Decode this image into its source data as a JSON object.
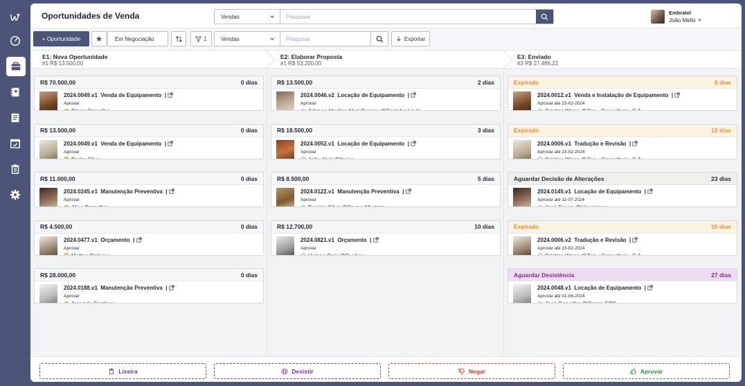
{
  "app": {
    "title": "Oportunidades de Venda"
  },
  "header_search": {
    "select": "Vendas",
    "placeholder": "Pesquisar"
  },
  "user": {
    "company": "Embratel",
    "name": "João Mello"
  },
  "toolbar": {
    "new_label": "+ Oportunidade",
    "status_filter": "Em Negociação",
    "filter_count": "1",
    "select": "Vendas",
    "placeholder": "Pesquisar",
    "export_label": "Exportar"
  },
  "stages": [
    {
      "name": "E1: Nova Oportunidade",
      "summary": "#1 R$ 13.500,00"
    },
    {
      "name": "E2: Elaborar Proposta",
      "summary": "#1 R$ 53.200,00"
    },
    {
      "name": "E3: Enviado",
      "summary": "#3 R$ 27.486,22"
    }
  ],
  "columns": [
    {
      "cards": [
        {
          "header": "R$ 70.500,00",
          "days": "0 dias",
          "ref": "2024.0049.v1",
          "title": "Venda de Equipamento",
          "action": "Aprovar",
          "who": "Diana Carvalho",
          "dot": "y"
        },
        {
          "header": "R$ 13.500,00",
          "days": "0 dias",
          "ref": "2024.0049.v1",
          "title": "Venda de Equipamento",
          "action": "Aprovar",
          "who": "Pedro Silva",
          "dot": "y"
        },
        {
          "header": "R$ 11.000,00",
          "days": "0 dias",
          "ref": "2024.0245.v1",
          "title": "Manutenção Preventiva",
          "action": "Aprovar",
          "who": "Alice Ramalho",
          "dot": "y"
        },
        {
          "header": "R$ 4.500,00",
          "days": "0 dias",
          "ref": "2024.0477.v1",
          "title": "Orçamento",
          "action": "Aprovar",
          "who": "Matteo Pinheiro",
          "dot": "y"
        },
        {
          "header": "R$ 28.000,00",
          "days": "0 dias",
          "ref": "2024.0188.v1",
          "title": "Manutenção Preventiva",
          "action": "Aprovar",
          "who": "Amanda Santiago",
          "dot": "y"
        }
      ]
    },
    {
      "cards": [
        {
          "header": "R$ 13.500,00",
          "days": "2 dias",
          "ref": "2024.0046.v2",
          "title": "Locação de Equipamento",
          "action": "Aprovar",
          "who": "Adriana Martins Abel Pereira @Cozinha Linda",
          "dot": "g"
        },
        {
          "header": "R$ 18.500,00",
          "days": "3 dias",
          "ref": "2024.0052.v1",
          "title": "Locação de Equipamento",
          "action": "Aprovar",
          "who": "João Abel @Itaúsa",
          "dot": "g"
        },
        {
          "header": "R$ 8.500,00",
          "days": "5 dias",
          "ref": "2024.0122.v1",
          "title": "Manutenção Preventiva",
          "action": "Aprovar",
          "who": "Benício Silva @Grupo Albatroz",
          "dot": "g"
        },
        {
          "header": "R$ 12.700,00",
          "days": "10 dias",
          "ref": "2024.0821.v1",
          "title": "Orçamento",
          "action": "Aprovar",
          "who": "Helena Reis @Dunbar",
          "dot": "g"
        }
      ]
    },
    {
      "cards": [
        {
          "header": "Expirado",
          "days": "8 dias",
          "style": "expired",
          "ref": "2024.0012.v1",
          "title": "Venda e Instalação de Equipamento",
          "action": "Aprovar até 23-02-2024",
          "who": "Cristina Wang @Zen - Consultoria, S.A",
          "dot": "g"
        },
        {
          "header": "Expirado",
          "days": "12 dias",
          "style": "expired",
          "ref": "2024.0006.v1",
          "title": "Tradução e Revisão",
          "action": "Aprovar até 23-02-2024",
          "who": "Cristina Wang @Zen - Consultoria, S.A",
          "dot": "g"
        },
        {
          "header": "Aguardar Decisão de Alterações",
          "days": "23 dias",
          "style": "await",
          "ref": "2024.0145.v1",
          "title": "Locação de Equipamento",
          "action": "Aprovar até 11-07-2024",
          "who": "José Sousa @Havaianas",
          "dot": "g"
        },
        {
          "header": "Expirado",
          "days": "26 dias",
          "style": "expired",
          "ref": "2024.0006.v2",
          "title": "Tradução e Revisão",
          "action": "Aprovar até 23-02-2024",
          "who": "Cristina Wang @Zen - Consultoria, S.A",
          "dot": "g"
        },
        {
          "header": "Aguardar Desistência",
          "days": "27 dias",
          "style": "desist",
          "ref": "2024.0048.v1",
          "title": "Locação de Equipamento",
          "action": "Aprovar até 01-06-2024",
          "who": "José Carvalho @Grupo GPS",
          "dot": "g"
        }
      ]
    }
  ],
  "footer": {
    "trash": "Lixeira",
    "desist": "Desistir",
    "deny": "Negar",
    "approve": "Aprovar"
  },
  "colors": {
    "brand": "#4a5578",
    "expired": "#e8912c",
    "desist": "#7b2f8a",
    "deny": "#c0392b",
    "approve": "#2e8b3a"
  }
}
